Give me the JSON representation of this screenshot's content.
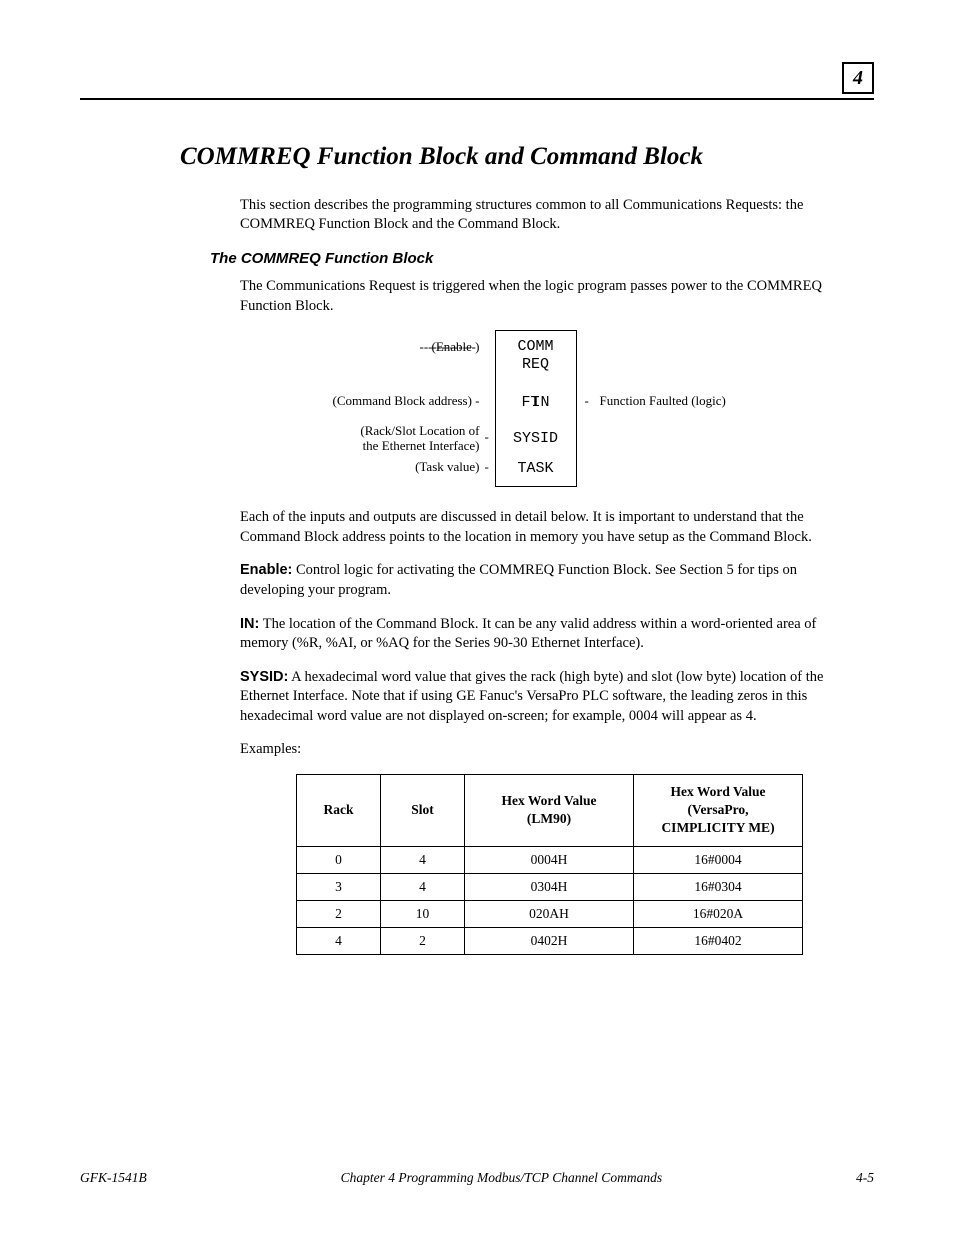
{
  "chapter_badge": "4",
  "section_title": "COMMREQ Function Block and Command Block",
  "intro": "This section describes the programming structures common to all Communications Requests: the COMMREQ Function Block and the Command Block.",
  "subhead": "The COMMREQ Function Block",
  "sub_intro": "The Communications Request is triggered when the logic program passes power to the COMMREQ Function Block.",
  "diagram": {
    "enable": "(Enable )",
    "dash": "-------------",
    "cmdblock": "(Command Block address)  -",
    "rackslot1": "(Rack/Slot Location of",
    "rackslot2": " the Ethernet Interface)",
    "rs_dash": "-",
    "taskval": "(Task value)",
    "tv_dash": "-",
    "box_comm": "COMM",
    "box_req": "REQ",
    "box_in": "IN",
    "box_ft": "FT",
    "box_sysid": "SYSID",
    "box_task": "TASK",
    "ft_dash": "-",
    "ft_label": "Function Faulted (logic)"
  },
  "after_diagram": "Each of the inputs and outputs are discussed in detail below.  It is important to understand that the Command Block address points to the location in memory you have setup as the Command Block.",
  "enable_label": "Enable:",
  "enable_text": "  Control logic for activating the COMMREQ Function Block. See Section 5 for tips on developing your program.",
  "in_label": "IN:",
  "in_text": "  The location of the Command Block.  It can be any valid address within a word-oriented area of memory (%R, %AI, or %AQ for the Series 90-30 Ethernet Interface).",
  "sysid_label": "SYSID:",
  "sysid_text": "  A hexadecimal word value that gives the rack (high byte) and slot (low byte) location of the Ethernet Interface. Note that if using GE Fanuc's VersaPro PLC software, the leading zeros in this hexadecimal word value are not displayed on-screen; for example, 0004 will appear as 4.",
  "examples_label": "Examples:",
  "table": {
    "headers": {
      "rack": "Rack",
      "slot": "Slot",
      "lm90": "Hex Word Value (LM90)",
      "vp": "Hex Word Value (VersaPro, CIMPLICITY ME)"
    },
    "rows": [
      {
        "rack": "0",
        "slot": "4",
        "lm90": "0004H",
        "vp": "16#0004"
      },
      {
        "rack": "3",
        "slot": "4",
        "lm90": "0304H",
        "vp": "16#0304"
      },
      {
        "rack": "2",
        "slot": "10",
        "lm90": "020AH",
        "vp": "16#020A"
      },
      {
        "rack": "4",
        "slot": "2",
        "lm90": "0402H",
        "vp": "16#0402"
      }
    ]
  },
  "footer": {
    "left": "GFK-1541B",
    "mid": "Chapter 4  Programming Modbus/TCP Channel Commands",
    "right": "4-5"
  }
}
